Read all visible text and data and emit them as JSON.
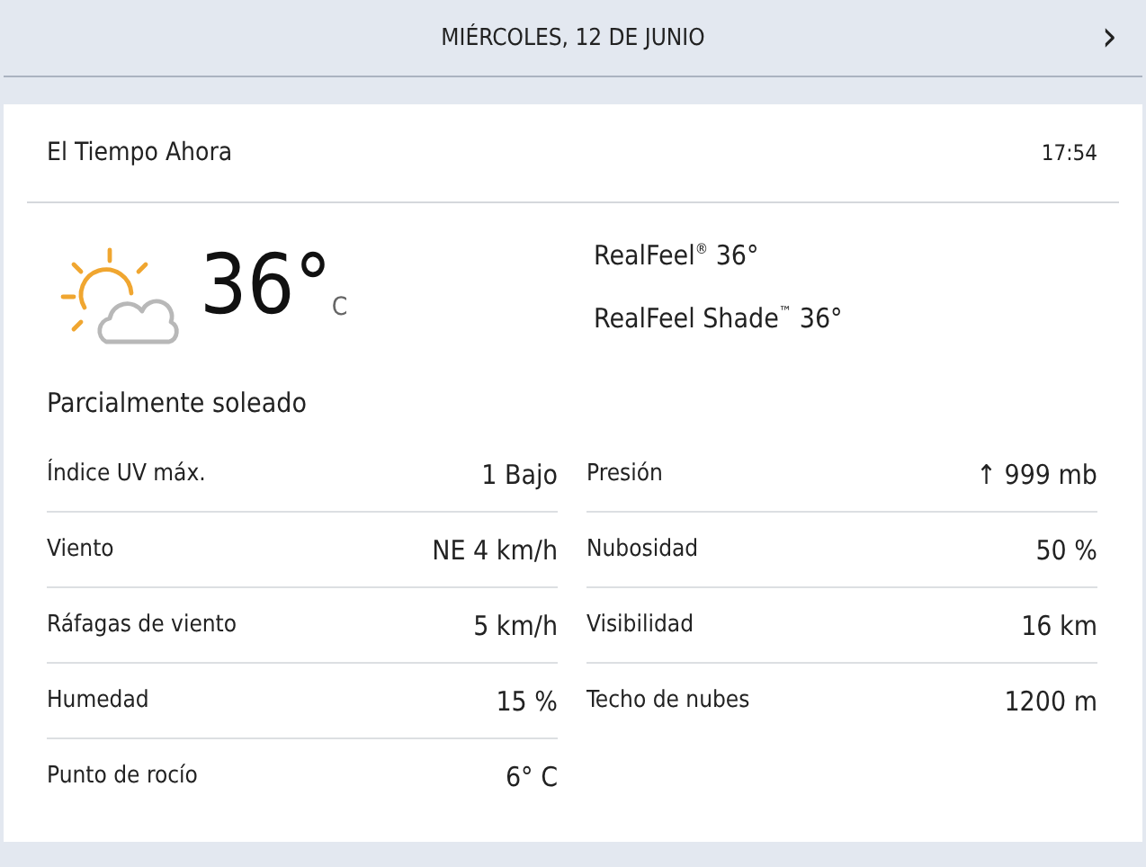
{
  "header": {
    "date": "MIÉRCOLES, 12 DE JUNIO",
    "next": "›"
  },
  "card": {
    "title": "El Tiempo Ahora",
    "time": "17:54",
    "current": {
      "temperature": "36°",
      "unit": "C",
      "realfeel": [
        "RealFeel$^{®}$ 36°",
        "RealFeel Shade$^{™}$ 36°"
      ],
      "condition": "Parcialmente soleado"
    },
    "details_left": [
      {
        "label": "Índice UV máx.",
        "value": "1 Bajo"
      },
      {
        "label": "Viento",
        "value": "NE 4 km/h"
      },
      {
        "label": "Ráfagas de viento",
        "value": "5 km/h"
      },
      {
        "label": "Humedad",
        "value": "15 %"
      },
      {
        "label": "Punto de rocío",
        "value": "6° C"
      }
    ],
    "details_right": [
      {
        "label": "Presión",
        "value": "↑ 999 mb"
      },
      {
        "label": "Nubosidad",
        "value": "50 %"
      },
      {
        "label": "Visibilidad",
        "value": "16 km"
      },
      {
        "label": "Techo de nubes",
        "value": "1200 m"
      }
    ]
  }
}
